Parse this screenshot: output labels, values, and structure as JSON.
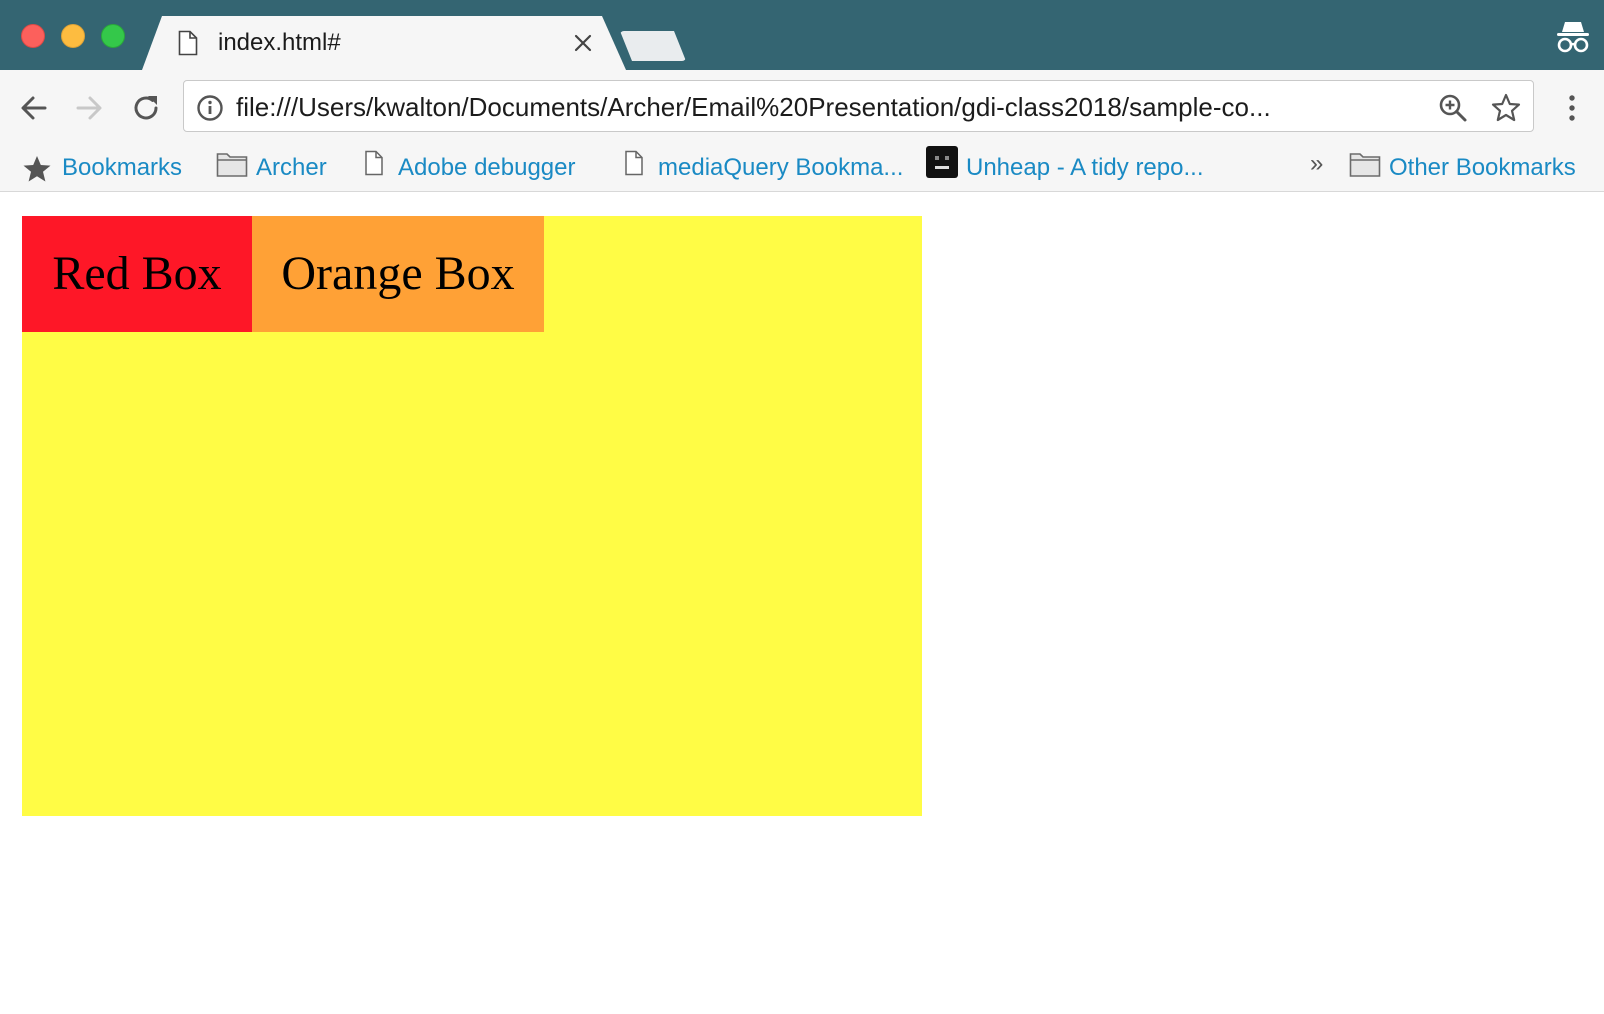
{
  "colors": {
    "tabstrip": "#346572",
    "yellow_box": "#fffc45",
    "red_box": "#fe1727",
    "orange_box": "#ffa136",
    "bookmark_text": "#1a8ac4"
  },
  "tab": {
    "title": "index.html#",
    "icon": "document-icon"
  },
  "toolbar": {
    "url": "file:///Users/kwalton/Documents/Archer/Email%20Presentation/gdi-class2018/sample-co..."
  },
  "bookmarks": {
    "items": [
      {
        "label": "Bookmarks",
        "icon": "star-icon"
      },
      {
        "label": "Archer",
        "icon": "folder-icon"
      },
      {
        "label": "Adobe debugger",
        "icon": "document-icon"
      },
      {
        "label": "mediaQuery Bookma...",
        "icon": "document-icon"
      },
      {
        "label": "Unheap - A tidy repo...",
        "icon": "unheap-favicon"
      }
    ],
    "more": "»",
    "other": {
      "label": "Other Bookmarks",
      "icon": "folder-icon"
    }
  },
  "page": {
    "red_box_label": "Red Box",
    "orange_box_label": "Orange Box"
  }
}
